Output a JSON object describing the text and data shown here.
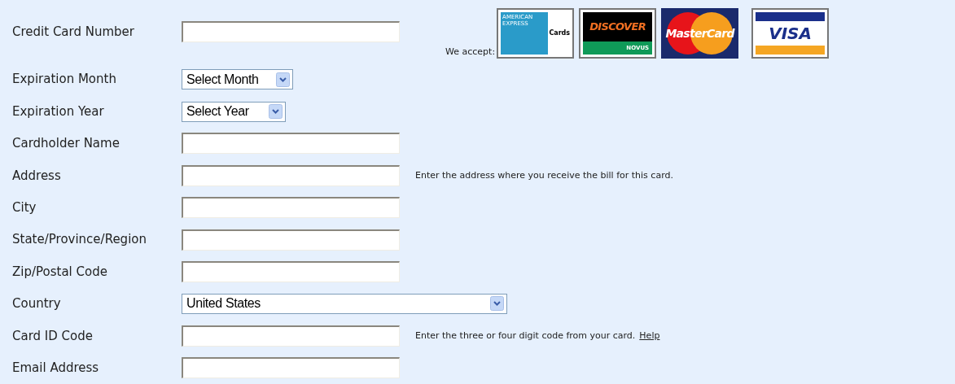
{
  "accept_label": "We accept:",
  "cards": [
    {
      "kind": "amex",
      "texts": [
        "AMERICAN",
        "EXPRESS",
        "Cards"
      ]
    },
    {
      "kind": "discover",
      "texts": [
        "DISCOVER",
        "NOVUS"
      ]
    },
    {
      "kind": "mastercard",
      "texts": [
        "MasterCard"
      ]
    },
    {
      "kind": "visa",
      "texts": [
        "VISA"
      ]
    }
  ],
  "fields": [
    {
      "kind": "text",
      "label": "Credit Card Number"
    },
    {
      "kind": "select",
      "label": "Expiration Month",
      "value": "Select Month"
    },
    {
      "kind": "select",
      "label": "Expiration Year",
      "value": "Select Year"
    },
    {
      "kind": "text",
      "label": "Cardholder Name"
    },
    {
      "kind": "text",
      "label": "Address",
      "note": "Enter the address where you receive the bill for this card."
    },
    {
      "kind": "text",
      "label": "City"
    },
    {
      "kind": "text",
      "label": "State/Province/Region"
    },
    {
      "kind": "text",
      "label": "Zip/Postal Code"
    },
    {
      "kind": "select",
      "label": "Country",
      "value": "United States"
    },
    {
      "kind": "text",
      "label": "Card ID Code",
      "note": "Enter the three or four digit code from your card.",
      "link": "Help"
    },
    {
      "kind": "text",
      "label": "Email Address"
    }
  ]
}
